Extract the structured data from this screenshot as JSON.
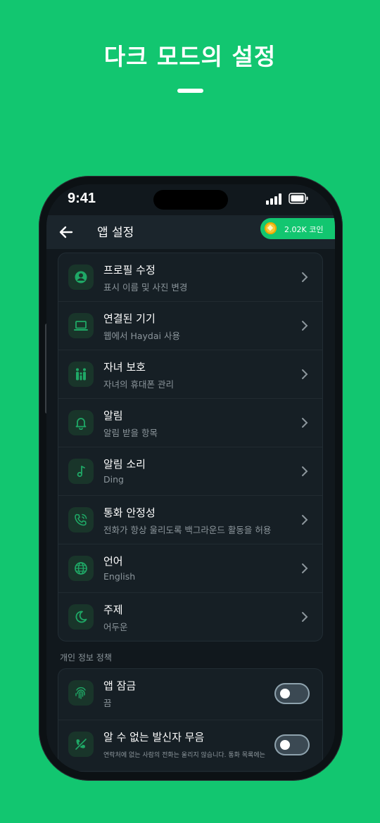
{
  "headline": "다크 모드의 설정",
  "status": {
    "time": "9:41"
  },
  "appbar": {
    "title": "앱 설정",
    "coins": "2.02K 코인"
  },
  "settings": [
    {
      "title": "프로필 수정",
      "subtitle": "표시 이름 및 사진 변경",
      "icon": "account-icon"
    },
    {
      "title": "연결된 기기",
      "subtitle": "웹에서 Haydai 사용",
      "icon": "laptop-icon"
    },
    {
      "title": "자녀 보호",
      "subtitle": "자녀의 휴대폰 관리",
      "icon": "family-icon"
    },
    {
      "title": "알림",
      "subtitle": "알림 받을 항목",
      "icon": "bell-icon"
    },
    {
      "title": "알림 소리",
      "subtitle": "Ding",
      "icon": "music-note-icon"
    },
    {
      "title": "통화 안정성",
      "subtitle": "전화가 항상 울리도록 백그라운드 활동을 허용",
      "icon": "phone-call-icon"
    },
    {
      "title": "언어",
      "subtitle": "English",
      "icon": "globe-icon"
    },
    {
      "title": "주제",
      "subtitle": "어두운",
      "icon": "moon-icon"
    }
  ],
  "privacy": {
    "label": "개인 정보 정책",
    "items": [
      {
        "title": "앱 잠금",
        "subtitle": "끔",
        "icon": "fingerprint-icon",
        "enabled": false
      },
      {
        "title": "알 수 없는 발신자 무음",
        "subtitle": "연락처에 없는 사람의 전화는 울리지 않습니다. 통화 목록에는",
        "icon": "phone-muted-icon",
        "enabled": false
      }
    ]
  },
  "colors": {
    "brand": "#12C670",
    "background": "#11181D",
    "card": "#161F25",
    "icon_bg": "#19352A"
  }
}
